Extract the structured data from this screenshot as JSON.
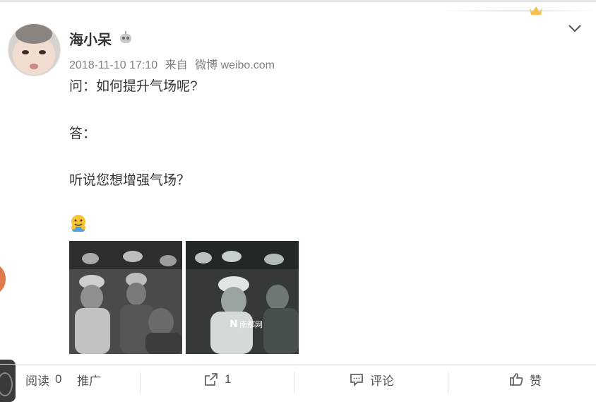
{
  "post": {
    "username": "海小呆",
    "timestamp": "2018-11-10 17:10",
    "source_prefix": "来自",
    "source_app": "微博 weibo.com",
    "content_lines": [
      "问：如何提升气场呢?",
      "答：",
      "听说您想增强气场？"
    ],
    "emoji_name": "hug-emoji",
    "images": [
      {
        "name": "post-image-1",
        "watermark": ""
      },
      {
        "name": "post-image-2",
        "watermark": "南都网"
      }
    ]
  },
  "icons": {
    "robot": "robot-badge-icon",
    "crown": "crown-icon",
    "chevron": "chevron-down-icon",
    "share": "share-icon",
    "comment": "comment-icon",
    "like": "thumbs-up-icon"
  },
  "footer": {
    "read_label": "阅读",
    "read_count": "0",
    "promote_label": "推广",
    "share_count": "1",
    "comment_label": "评论",
    "like_label": "赞"
  },
  "colors": {
    "text": "#333333",
    "meta": "#808080",
    "crown": "#f4c04f"
  }
}
